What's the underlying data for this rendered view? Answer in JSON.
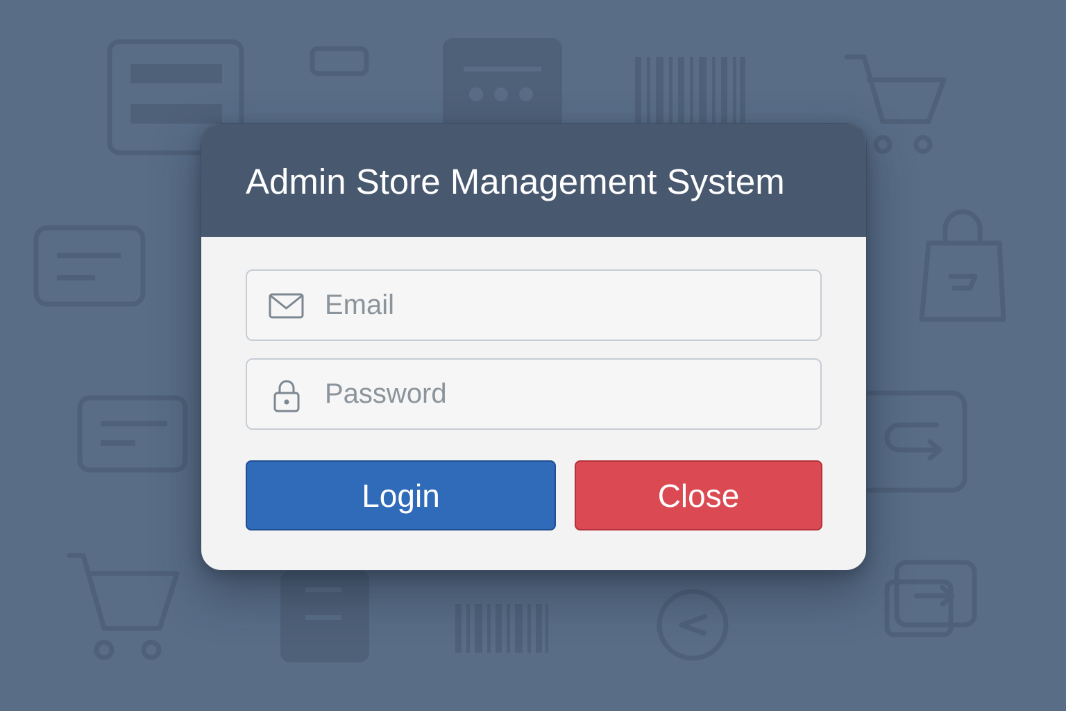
{
  "dialog": {
    "title": "Admin Store Management System"
  },
  "form": {
    "email": {
      "placeholder": "Email",
      "value": "",
      "icon": "envelope-icon"
    },
    "password": {
      "placeholder": "Password",
      "value": "",
      "icon": "lock-icon"
    }
  },
  "actions": {
    "login_label": "Login",
    "close_label": "Close"
  },
  "colors": {
    "background": "#596d87",
    "header": "#48586f",
    "body": "#f3f3f3",
    "login": "#2f6bb8",
    "close": "#db4a53"
  },
  "background_icons": [
    "store-shelf-icon",
    "card-icon",
    "receipt-icon",
    "barcode-icon",
    "shopping-cart-icon",
    "shopping-bag-icon",
    "return-icon",
    "phone-icon",
    "clock-icon",
    "wallet-icon"
  ]
}
